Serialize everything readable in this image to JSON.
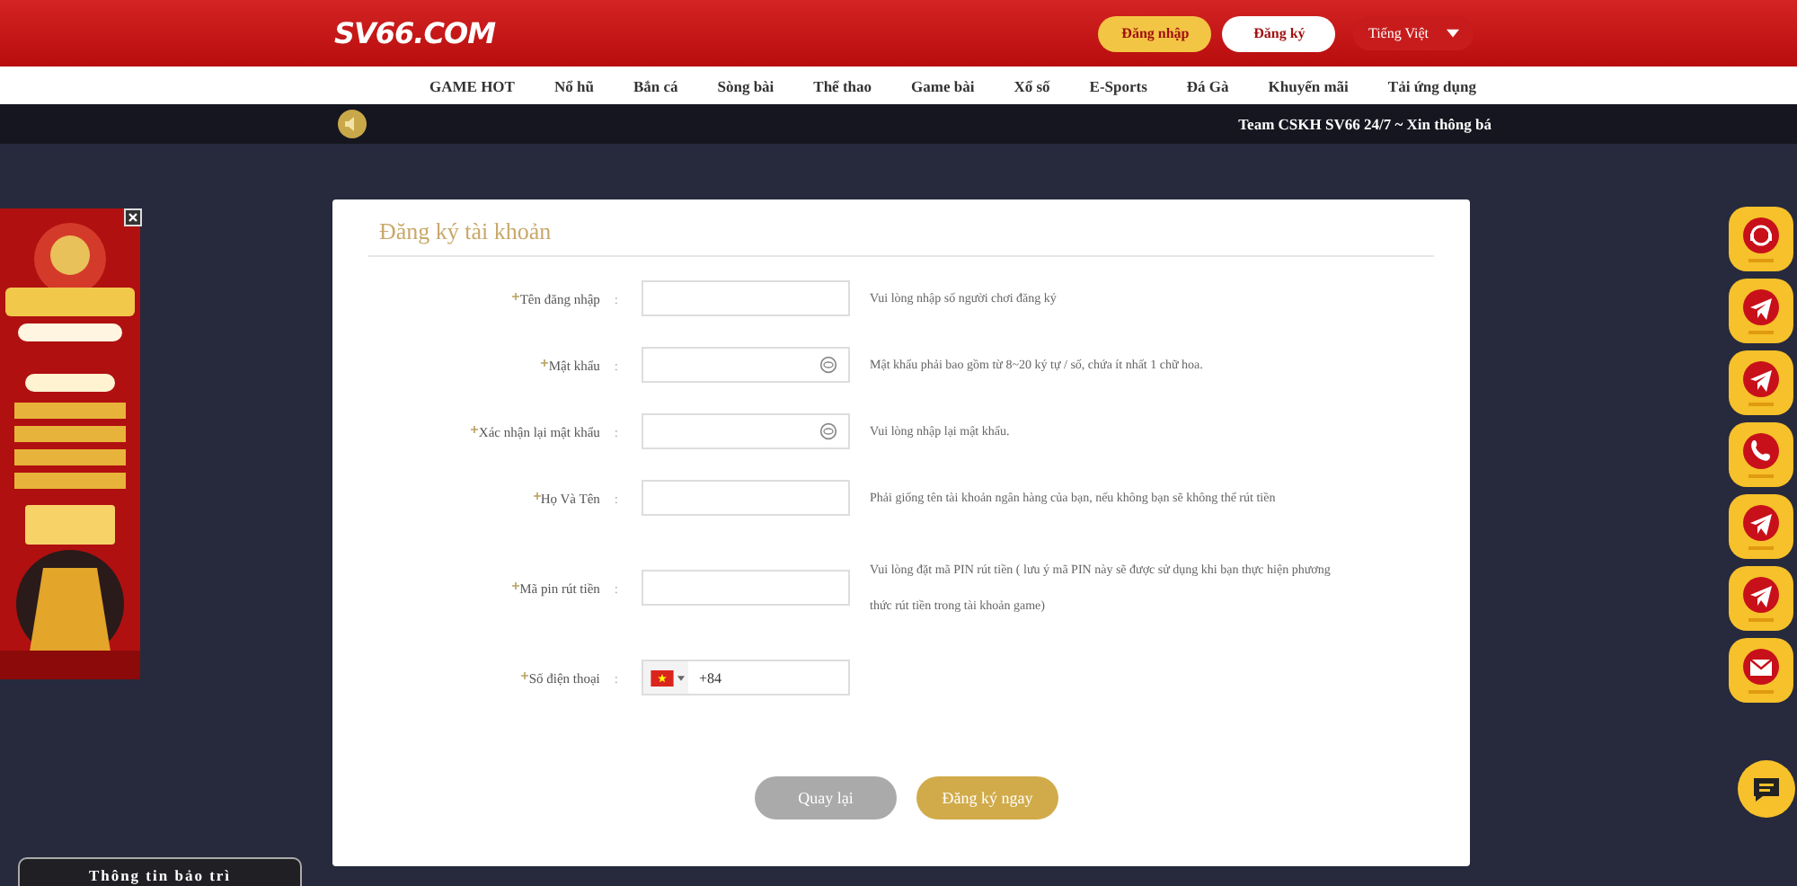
{
  "header": {
    "logo": "SV66.COM",
    "login_button": "Đăng nhập",
    "register_button": "Đăng ký",
    "language": "Tiếng Việt"
  },
  "nav": [
    "GAME HOT",
    "Nổ hũ",
    "Bắn cá",
    "Sòng bài",
    "Thể thao",
    "Game bài",
    "Xổ số",
    "E-Sports",
    "Đá Gà",
    "Khuyến mãi",
    "Tải ứng dụng"
  ],
  "announcement": "Team CSKH SV66 24/7 ~ Xin thông bá",
  "form": {
    "title": "Đăng ký tài khoản",
    "fields": [
      {
        "label": "Tên đăng nhập",
        "separator": ":",
        "kind": "text",
        "hint": "Vui lòng nhập số người chơi đăng ký"
      },
      {
        "label": "Mật khẩu",
        "separator": ":",
        "kind": "password",
        "hint": "Mật khẩu phải bao gồm từ 8~20 ký tự / số, chứa ít nhất 1 chữ hoa."
      },
      {
        "label": "Xác nhận lại mật khẩu",
        "separator": ":",
        "kind": "password",
        "hint": "Vui lòng nhập lại mật khẩu."
      },
      {
        "label": "Họ Và Tên",
        "separator": ":",
        "kind": "text",
        "hint": "Phải giống tên tài khoản ngân hàng của bạn, nếu không bạn sẽ không thể rút tiền"
      },
      {
        "label": "Mã pin rút tiền",
        "separator": ":",
        "kind": "text",
        "hint": "Vui lòng đặt mã PIN rút tiền ( lưu ý mã PIN này sẽ được sử dụng khi bạn thực hiện phương thức rút tiền trong tài khoản game)"
      },
      {
        "label": "Số điện thoại",
        "separator": ":",
        "kind": "phone",
        "value": "+84"
      }
    ],
    "back_button": "Quay lại",
    "submit_button": "Đăng ký ngay"
  },
  "side_contacts": [
    {
      "kind": "support"
    },
    {
      "kind": "telegram"
    },
    {
      "kind": "telegram"
    },
    {
      "kind": "phone"
    },
    {
      "kind": "telegram"
    },
    {
      "kind": "telegram"
    },
    {
      "kind": "mail"
    }
  ],
  "maintenance_tab": "Thông tin bảo trì"
}
